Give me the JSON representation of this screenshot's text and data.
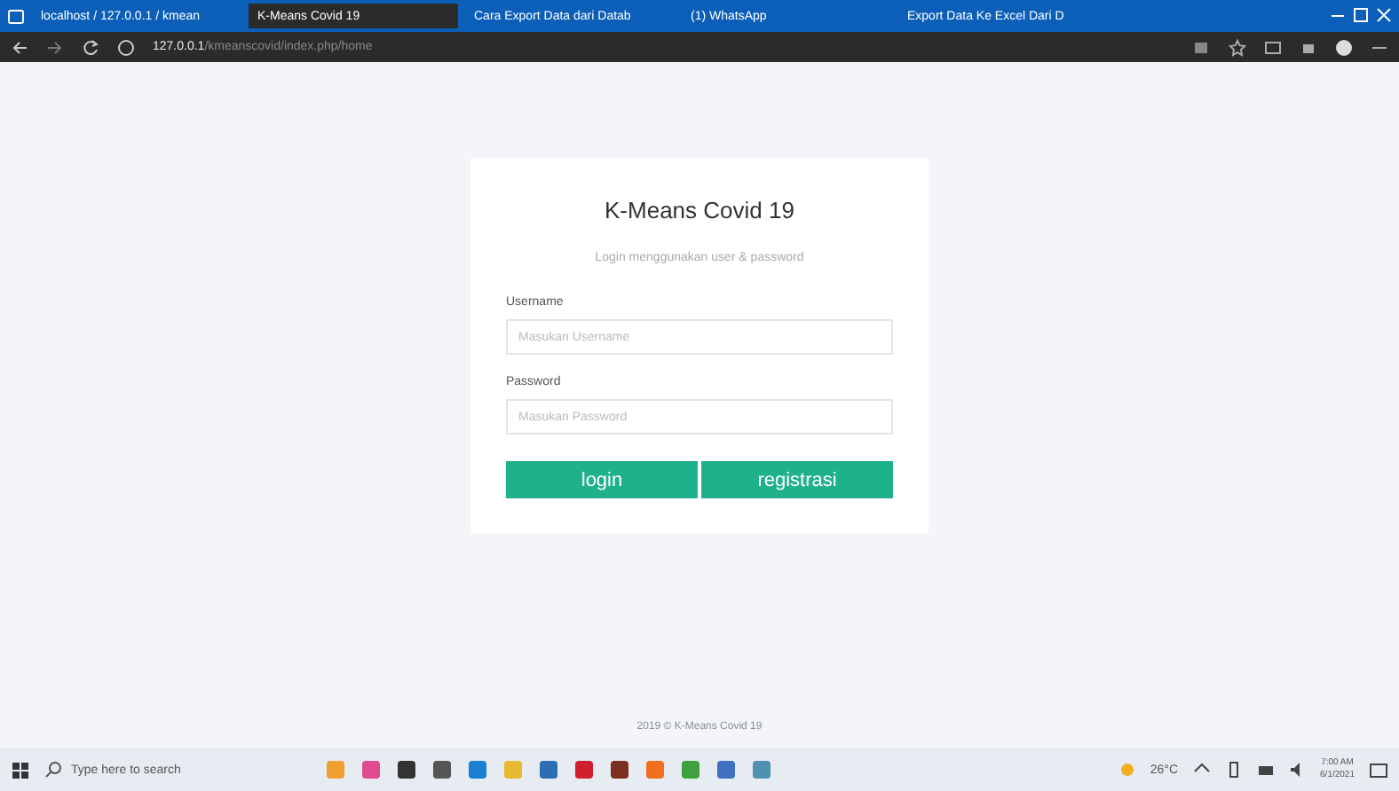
{
  "browser": {
    "tabs": [
      {
        "title": "localhost / 127.0.0.1 / kmean",
        "selected": false
      },
      {
        "title": "K-Means Covid 19",
        "selected": true
      },
      {
        "title": "Cara Export Data dari Datab",
        "selected": false
      },
      {
        "title": "(1) WhatsApp",
        "selected": false
      },
      {
        "title": "Export Data Ke Excel Dari D",
        "selected": false
      }
    ],
    "url_host": "127.0.0.1",
    "url_path": "/kmeanscovid/index.php/home"
  },
  "login": {
    "title": "K-Means Covid 19",
    "subtitle": "Login menggunakan user & password",
    "fields": [
      {
        "label": "Username",
        "placeholder": "Masukan Username"
      },
      {
        "label": "Password",
        "placeholder": "Masukan Password"
      }
    ],
    "buttons": [
      "login",
      "registrasi"
    ]
  },
  "footer": "2019 © K-Means Covid 19",
  "taskbar": {
    "search_placeholder": "Type here to search",
    "weather": "26°C",
    "time": "7:00 AM",
    "date": "6/1/2021"
  }
}
